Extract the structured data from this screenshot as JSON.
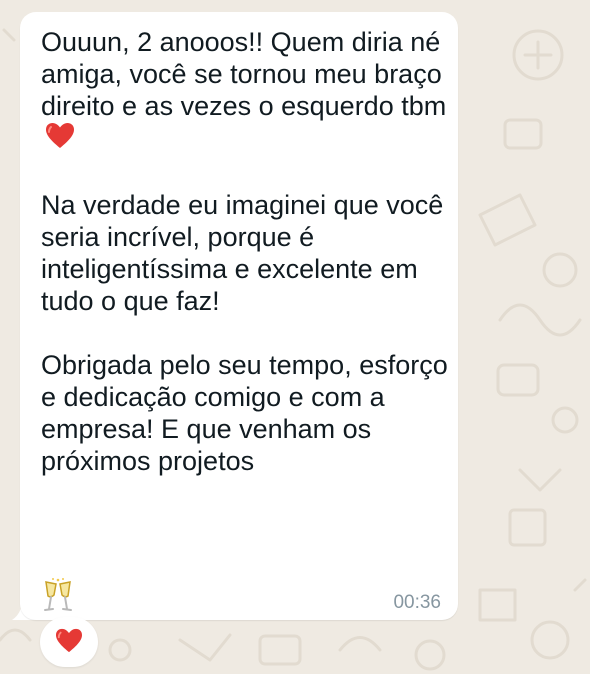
{
  "chat": {
    "message": {
      "paragraphs": [
        {
          "text": "Ouuun, 2 anooos!! Quem diria né amiga, você se tornou meu braço direito e as vezes o esquerdo tbm",
          "trailing_emoji": "red-heart-icon"
        },
        {
          "text": "Na verdade eu imaginei que você seria incrível, porque é inteligentíssima e excelente em tudo o que faz!"
        },
        {
          "text": "Obrigada pelo seu tempo, esforço e dedicação comigo e com a empresa! E que venham os próximos projetos",
          "trailing_emoji": "clinking-glasses-icon"
        }
      ],
      "timestamp": "00:36"
    },
    "reaction": {
      "emoji": "red-heart-icon"
    }
  },
  "colors": {
    "wallpaper": "#efeae2",
    "bubble": "#ffffff",
    "text": "#111b21",
    "timestamp": "#8696a0",
    "heart": "#e53935"
  }
}
